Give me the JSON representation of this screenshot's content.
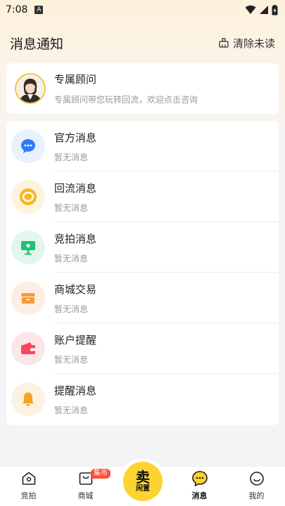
{
  "status_bar": {
    "time": "7:08",
    "notif_icon": "A"
  },
  "header": {
    "title": "消息通知",
    "clear_label": "清除未读"
  },
  "advisor": {
    "title": "专属顾问",
    "subtitle": "专属顾问带您玩转回流，欢迎点击咨询"
  },
  "messages": [
    {
      "title": "官方消息",
      "subtitle": "暂无消息",
      "icon": "chat-bubble-icon",
      "color": "#2e7cf6",
      "bg": "#e8f1fe"
    },
    {
      "title": "回流消息",
      "subtitle": "暂无消息",
      "icon": "recycle-icon",
      "color": "#f9b821",
      "bg": "#fdf4df"
    },
    {
      "title": "竞拍消息",
      "subtitle": "暂无消息",
      "icon": "auction-icon",
      "color": "#21c07a",
      "bg": "#e3f6ec"
    },
    {
      "title": "商城交易",
      "subtitle": "暂无消息",
      "icon": "store-icon",
      "color": "#f59b3a",
      "bg": "#fdeee2"
    },
    {
      "title": "账户提醒",
      "subtitle": "暂无消息",
      "icon": "wallet-icon",
      "color": "#f5475d",
      "bg": "#fde6e9"
    },
    {
      "title": "提醒消息",
      "subtitle": "暂无消息",
      "icon": "bell-icon",
      "color": "#f6a321",
      "bg": "#fdf1e0"
    }
  ],
  "tabbar": {
    "tabs": [
      {
        "label": "竞拍",
        "icon": "home-icon"
      },
      {
        "label": "商城",
        "icon": "shopping-bag-icon",
        "badge": "集市"
      },
      {
        "label": "消息",
        "icon": "message-icon",
        "active": true
      },
      {
        "label": "我的",
        "icon": "profile-icon"
      }
    ],
    "sell": {
      "main": "卖",
      "sub": "闲置"
    }
  },
  "colors": {
    "accent": "#fcd330",
    "badge": "#ff4d3a"
  }
}
